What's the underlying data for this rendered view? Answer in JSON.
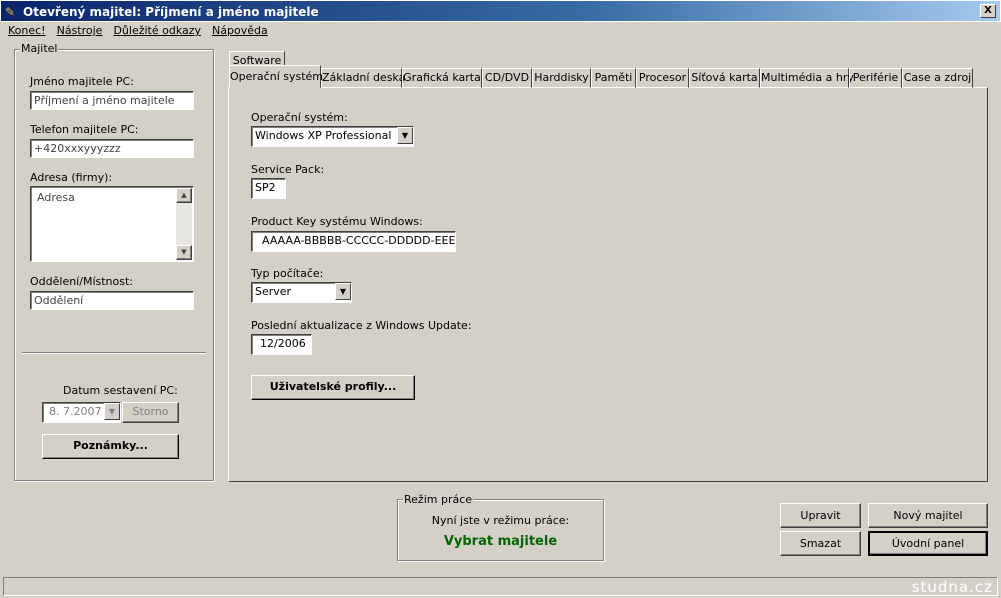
{
  "window": {
    "title": "Otevřený majitel: Příjmení a jméno majitele",
    "close": "X"
  },
  "menu": [
    "Konec!",
    "Nástroje",
    "Důležité odkazy",
    "Nápověda"
  ],
  "owner": {
    "group": "Majitel",
    "name_label": "Jméno majitele PC:",
    "name_value": "Příjmení a jméno majitele",
    "phone_label": "Telefon majitele PC:",
    "phone_value": "+420xxxyyyzzz",
    "address_label": "Adresa (firmy):",
    "address_value": "Adresa",
    "dept_label": "Oddělení/Místnost:",
    "dept_value": "Oddělení",
    "date_label": "Datum sestavení PC:",
    "date_value": "8. 7.2007",
    "storno": "Storno",
    "notes": "Poznámky..."
  },
  "tabs": {
    "upper": "Software",
    "lower": [
      "Operační systém",
      "Základní deska",
      "Grafická karta",
      "CD/DVD",
      "Harddisky",
      "Paměti",
      "Procesor",
      "Síťová karta",
      "Multimédia a hry",
      "Periférie",
      "Case a zdroj"
    ]
  },
  "os": {
    "os_label": "Operační systém:",
    "os_value": "Windows XP Professional",
    "sp_label": "Service Pack:",
    "sp_value": "SP2",
    "key_label": "Product Key systému Windows:",
    "key_value": "AAAAA-BBBBB-CCCCC-DDDDD-EEEEE",
    "type_label": "Typ počítače:",
    "type_value": "Server",
    "update_label": "Poslední aktualizace z Windows Update:",
    "update_value": "12/2006",
    "profiles": "Uživatelské profily..."
  },
  "mode": {
    "group": "Režim práce",
    "text": "Nyní jste v režimu práce:",
    "value": "Vybrat majitele",
    "color": "#006400"
  },
  "buttons": {
    "edit": "Upravit",
    "new": "Nový majitel",
    "delete": "Smazat",
    "home": "Úvodní panel"
  },
  "status": {
    "watermark": "studna.cz"
  }
}
